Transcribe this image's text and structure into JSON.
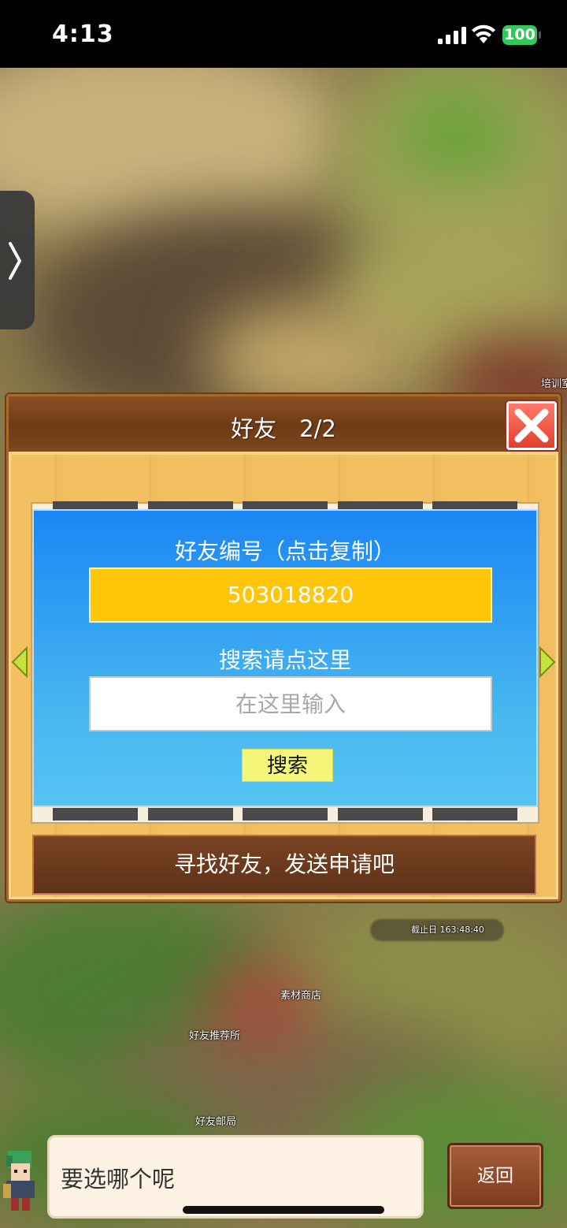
{
  "status_bar": {
    "time": "4:13",
    "battery": "100"
  },
  "map_labels": {
    "training": "培训室",
    "deadline": "截止日 163:48:40",
    "material_shop": "素材商店",
    "friend_recommend": "好友推荐所",
    "friend_post": "好友邮局"
  },
  "dialog": {
    "title": "好友　2/2",
    "id_label": "好友编号（点击复制）",
    "friend_id": "503018820",
    "search_hint": "搜索请点这里",
    "search_placeholder": "在这里输入",
    "search_button": "搜索",
    "find_friends": "寻找好友，发送申请吧"
  },
  "bottom": {
    "message": "要选哪个呢",
    "back_button": "返回"
  },
  "colors": {
    "id_box": "#ffc60a",
    "panel_top": "#1a86f5",
    "panel_bottom": "#55c3f2",
    "close": "#e23e2d",
    "search_button": "#f5f57a"
  },
  "icons": [
    "signal-icon",
    "wifi-icon",
    "battery-icon",
    "chevron-right-icon",
    "close-icon",
    "arrow-left-icon",
    "arrow-right-icon",
    "character-avatar"
  ]
}
